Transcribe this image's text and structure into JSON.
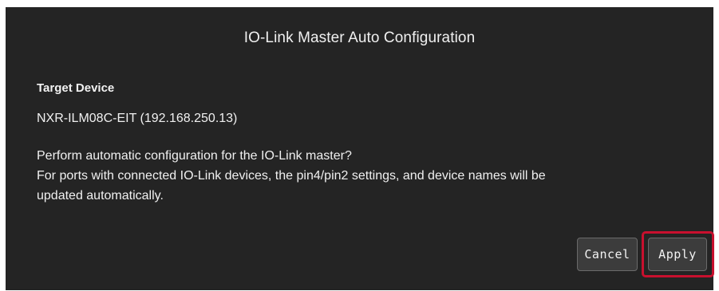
{
  "dialog": {
    "title": "IO-Link Master Auto Configuration",
    "section_heading": "Target Device",
    "device_name": "NXR-ILM08C-EIT (192.168.250.13)",
    "message_lines": [
      "Perform automatic configuration for the IO-Link master?",
      "For ports with connected IO-Link devices, the pin4/pin2 settings, and device names will be",
      "updated automatically."
    ],
    "buttons": {
      "cancel_label": "Cancel",
      "apply_label": "Apply"
    }
  },
  "colors": {
    "dialog_background": "#242424",
    "button_background": "#3c3c3c",
    "highlight_border": "#c8102e"
  }
}
